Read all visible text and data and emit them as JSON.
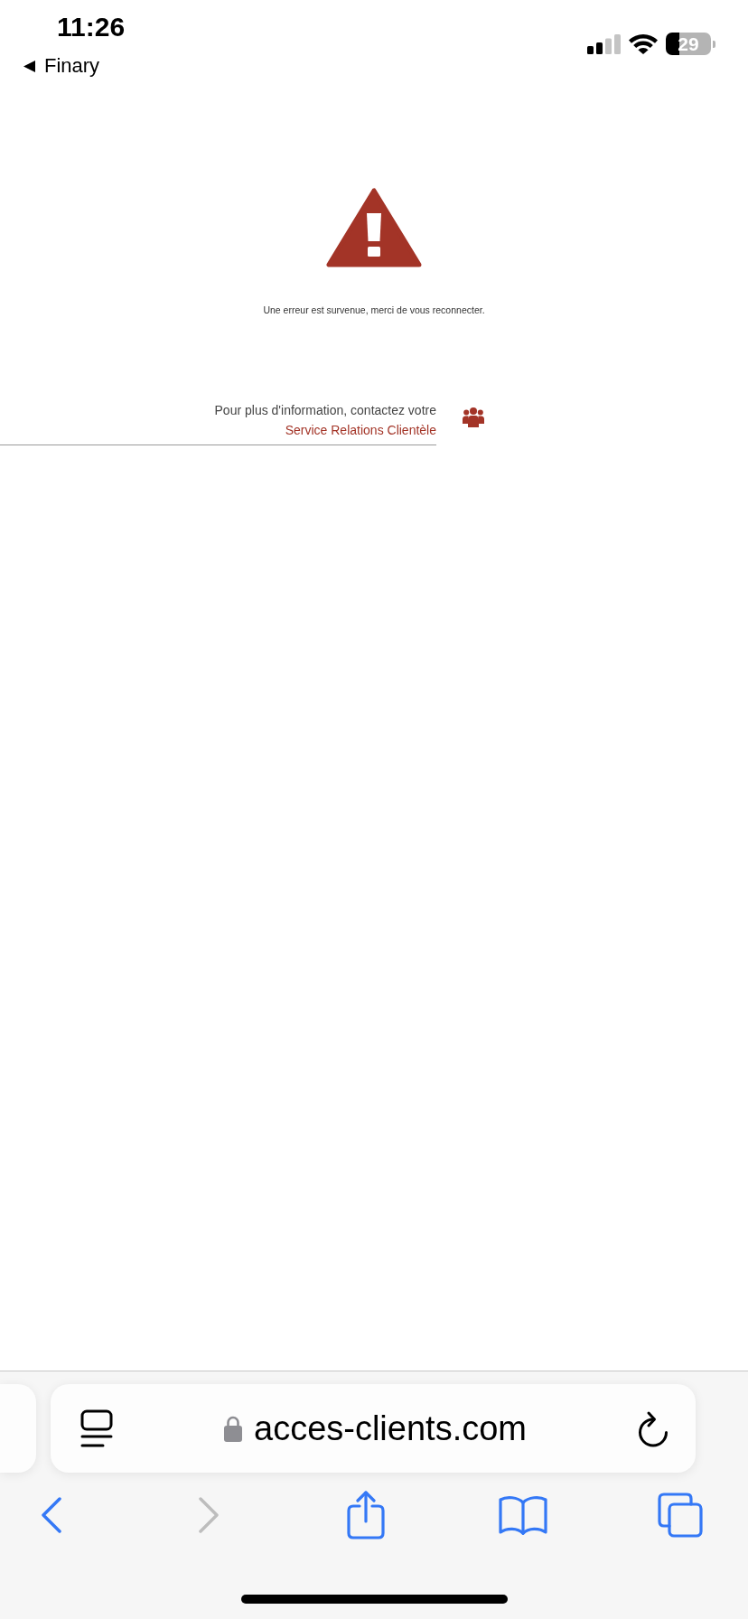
{
  "status_bar": {
    "time": "11:26",
    "back_link": "Finary",
    "battery": "29"
  },
  "error": {
    "message": "Une erreur est survenue, merci de vous reconnecter."
  },
  "contact": {
    "text": "Pour plus d'information, contactez votre",
    "link": "Service Relations Clientèle"
  },
  "address_bar": {
    "url": "acces-clients.com"
  },
  "toolbar": [
    {
      "kind": "back",
      "disabled": false
    },
    {
      "kind": "forward",
      "disabled": true
    },
    {
      "kind": "share",
      "disabled": false
    },
    {
      "kind": "bookmarks",
      "disabled": false
    },
    {
      "kind": "tabs",
      "disabled": false
    }
  ]
}
